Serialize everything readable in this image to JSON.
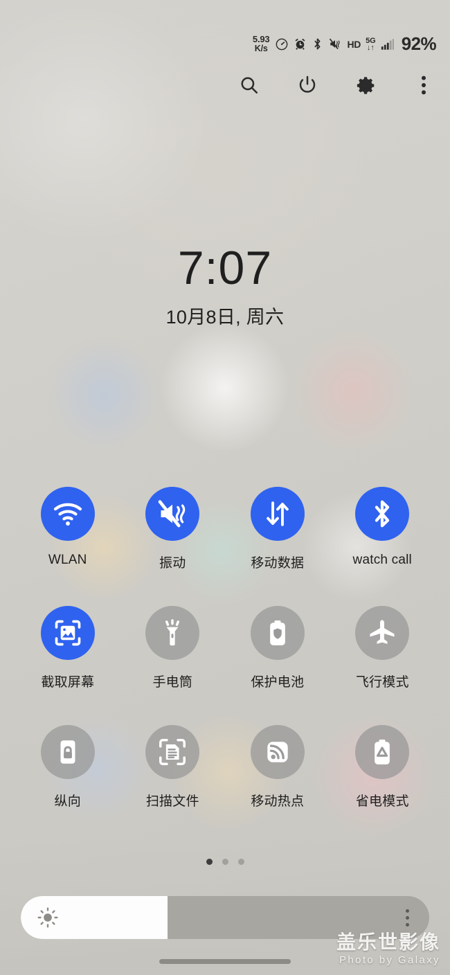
{
  "status_bar": {
    "net_speed_value": "5.93",
    "net_speed_unit": "K/s",
    "icons": [
      "speedometer-icon",
      "alarm-icon",
      "bluetooth-icon",
      "vibrate-mute-icon"
    ],
    "hd_label": "HD",
    "network_type": "5G",
    "network_arrows": "↓↑",
    "signal": "signal-bars-icon",
    "battery_percent": "92%"
  },
  "toolbar": {
    "search_label": "search-icon",
    "power_label": "power-icon",
    "settings_label": "gear-icon",
    "more_label": "more-vertical-icon"
  },
  "clock": {
    "time": "7:07",
    "date": "10月8日, 周六"
  },
  "tiles": [
    {
      "label": "WLAN",
      "icon": "wifi-icon",
      "active": true,
      "name": "tile-wlan"
    },
    {
      "label": "振动",
      "icon": "vibrate-icon",
      "active": true,
      "name": "tile-vibrate"
    },
    {
      "label": "移动数据",
      "icon": "mobile-data-icon",
      "active": true,
      "name": "tile-mobile-data"
    },
    {
      "label": "watch call",
      "icon": "bluetooth-icon",
      "active": true,
      "name": "tile-watch-call"
    },
    {
      "label": "截取屏幕",
      "icon": "screenshot-icon",
      "active": true,
      "name": "tile-screenshot"
    },
    {
      "label": "手电筒",
      "icon": "flashlight-icon",
      "active": false,
      "name": "tile-flashlight"
    },
    {
      "label": "保护电池",
      "icon": "protect-battery-icon",
      "active": false,
      "name": "tile-protect-battery"
    },
    {
      "label": "飞行模式",
      "icon": "airplane-icon",
      "active": false,
      "name": "tile-airplane-mode"
    },
    {
      "label": "纵向",
      "icon": "rotation-lock-icon",
      "active": false,
      "name": "tile-portrait-lock"
    },
    {
      "label": "扫描文件",
      "icon": "scan-document-icon",
      "active": false,
      "name": "tile-scan-document"
    },
    {
      "label": "移动热点",
      "icon": "hotspot-icon",
      "active": false,
      "name": "tile-mobile-hotspot"
    },
    {
      "label": "省电模式",
      "icon": "power-saving-icon",
      "active": false,
      "name": "tile-power-saving"
    }
  ],
  "pager": {
    "total": 3,
    "active_index": 0
  },
  "brightness": {
    "icon": "brightness-sun-icon",
    "value_percent": 36,
    "menu_icon": "more-vertical-icon"
  },
  "watermark": {
    "line1": "盖乐世影像",
    "line2": "Photo by Galaxy"
  },
  "colors": {
    "tile_active": "#2f62ef",
    "tile_inactive": "rgba(150,150,150,.70)",
    "text": "#1f1f1f",
    "background": "#d2d0ca"
  },
  "nav": {
    "handle": "gesture-handle"
  }
}
